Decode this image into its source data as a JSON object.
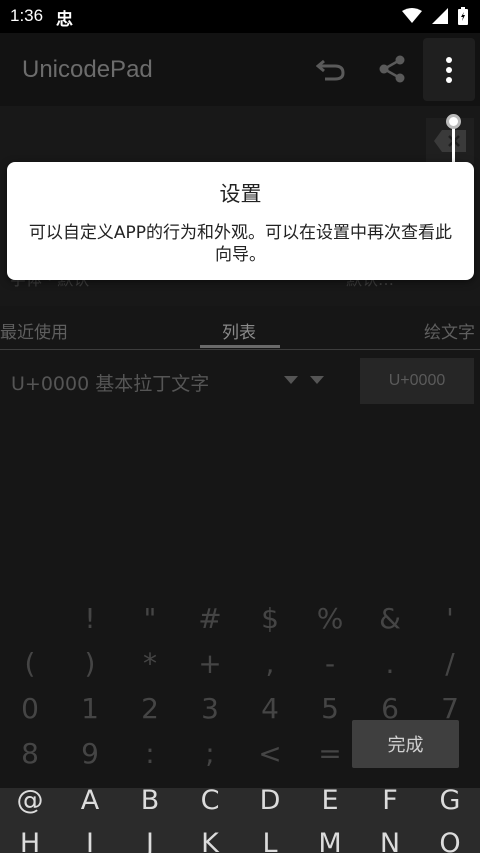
{
  "status_bar": {
    "time": "1:36",
    "notification_glyph": "忠",
    "icons": [
      "wifi-icon",
      "signal-icon",
      "battery-icon"
    ]
  },
  "app_bar": {
    "title": "UnicodePad",
    "actions": [
      "undo-icon",
      "share-icon",
      "more-vert-icon"
    ]
  },
  "edit_area": {
    "faint_left": "字体 · 默认",
    "faint_right": "默认…"
  },
  "tabs": {
    "items": [
      {
        "label": "最近使用",
        "active": false
      },
      {
        "label": "列表",
        "active": true
      },
      {
        "label": "绘文字",
        "active": false
      }
    ]
  },
  "block_selector": {
    "current_block": "U+0000 基本拉丁文字",
    "code_button": "U+0000"
  },
  "char_rows": [
    [
      " ",
      "!",
      "\"",
      "#",
      "$",
      "%",
      "&",
      "'"
    ],
    [
      "(",
      ")",
      "*",
      "+",
      ",",
      "-",
      ".",
      "/"
    ],
    [
      "0",
      "1",
      "2",
      "3",
      "4",
      "5",
      "6",
      "7"
    ],
    [
      "8",
      "9",
      ":",
      ";",
      "<",
      "=",
      ">",
      "?"
    ]
  ],
  "bright_rows": [
    [
      "@",
      "A",
      "B",
      "C",
      "D",
      "E",
      "F",
      "G"
    ],
    [
      "H",
      "I",
      "J",
      "K",
      "L",
      "M",
      "N",
      "O"
    ]
  ],
  "done_button": "完成",
  "dialog": {
    "title": "设置",
    "body": "可以自定义APP的行为和外观。可以在设置中再次查看此向导。"
  },
  "colors": {
    "background": "#161616",
    "dialog_bg": "#ffffff",
    "accent_dim": "#6a6a6a"
  }
}
